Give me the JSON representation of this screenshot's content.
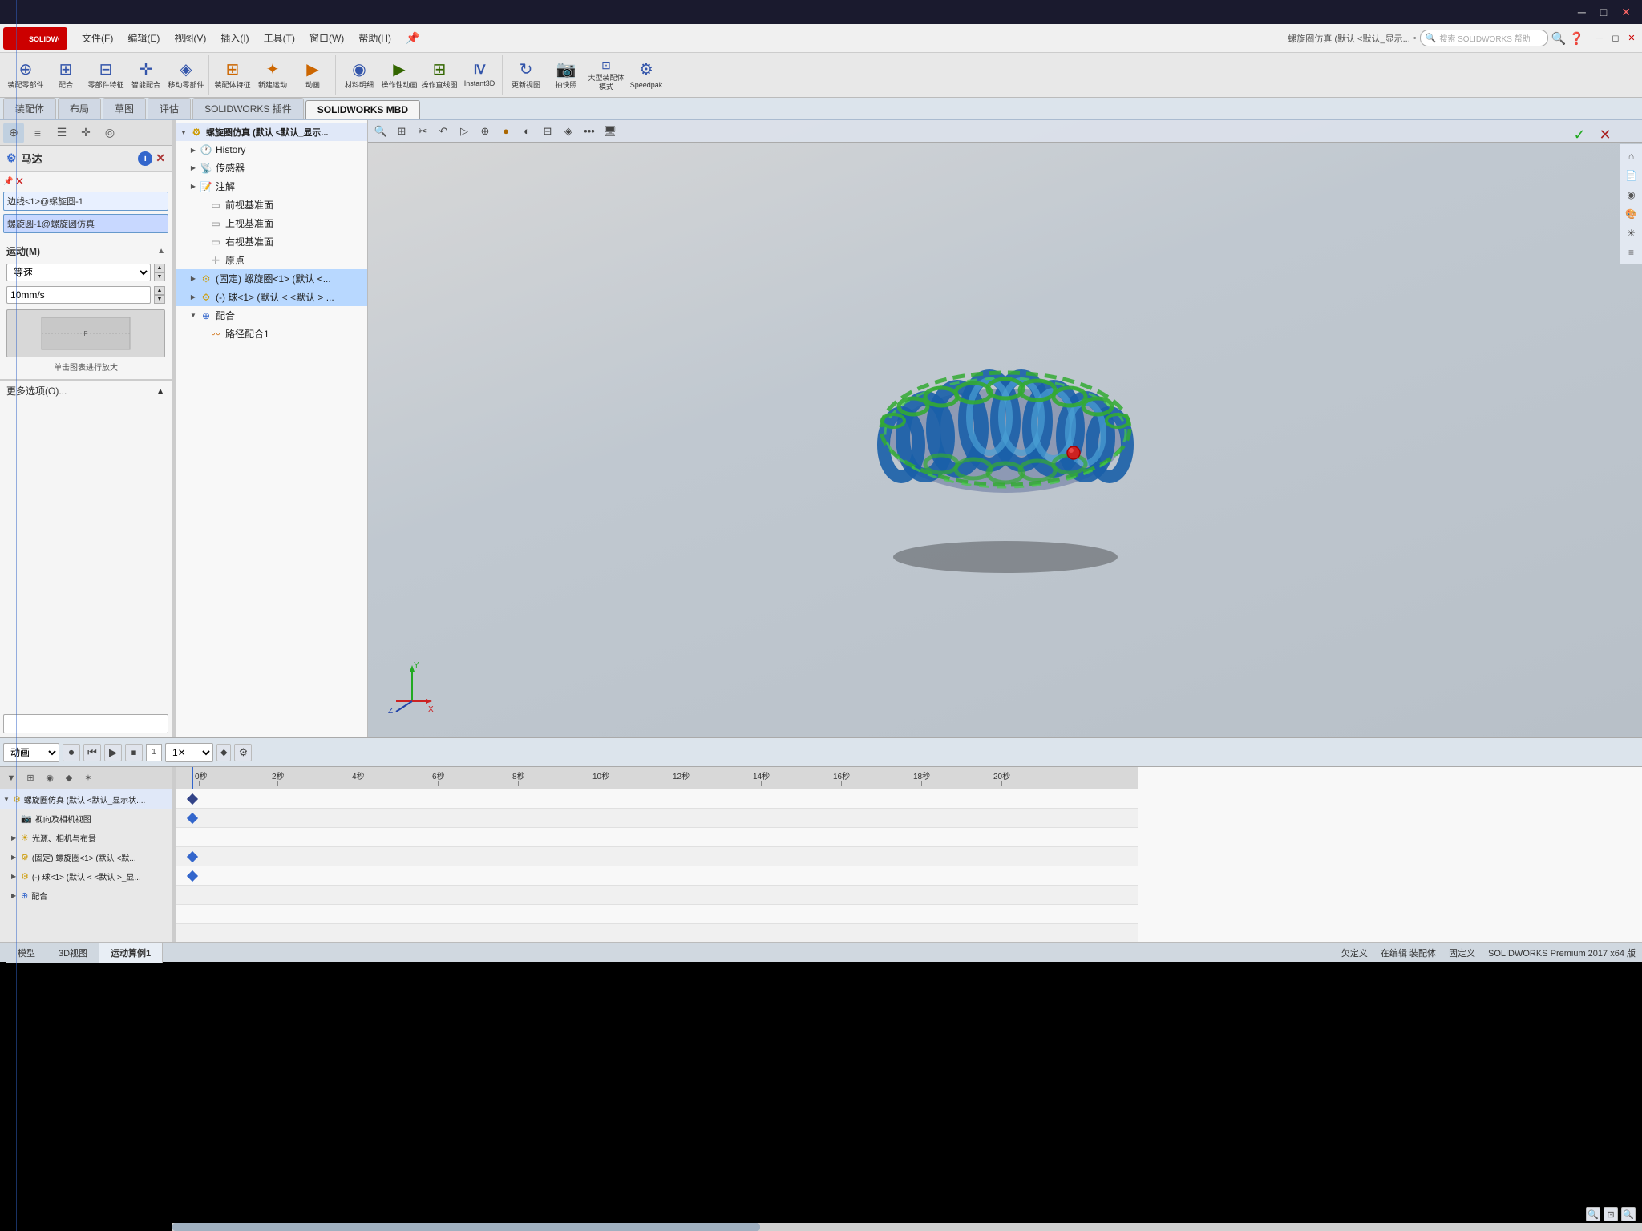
{
  "app": {
    "title": "SOLIDWORKS",
    "subtitle": "螺旋圈仿真 (默认 <默认_显示...",
    "version": "SOLIDWORKS Premium 2017 x64 版"
  },
  "titlebar": {
    "minimize": "─",
    "maximize": "□",
    "close": "✕"
  },
  "menubar": {
    "items": [
      {
        "label": "文件(F)"
      },
      {
        "label": "编辑(E)"
      },
      {
        "label": "视图(V)"
      },
      {
        "label": "插入(I)"
      },
      {
        "label": "工具(T)"
      },
      {
        "label": "窗口(W)"
      },
      {
        "label": "帮助(H)"
      }
    ],
    "search_placeholder": "搜索 SOLIDWORKS 帮助",
    "pin_label": "📌"
  },
  "toolbar": {
    "groups": [
      {
        "buttons": [
          {
            "icon": "◉",
            "label": "装配零部件",
            "color": "blue"
          },
          {
            "icon": "⊞",
            "label": "配合",
            "color": "blue"
          },
          {
            "icon": "⊟",
            "label": "零部件特征",
            "color": "blue"
          },
          {
            "icon": "✛",
            "label": "智能配合",
            "color": "blue"
          },
          {
            "icon": "⊕",
            "label": "移动零部件",
            "color": "blue"
          }
        ]
      },
      {
        "buttons": [
          {
            "icon": "⊞",
            "label": "装配体特征",
            "color": "orange"
          },
          {
            "icon": "✦",
            "label": "新建运动",
            "color": "orange"
          },
          {
            "icon": "⊞",
            "label": "动画",
            "color": "orange"
          }
        ]
      },
      {
        "buttons": [
          {
            "icon": "◈",
            "label": "材料明细",
            "color": "blue"
          },
          {
            "icon": "▶",
            "label": "操作性动画",
            "color": "green"
          },
          {
            "icon": "⊞",
            "label": "操作直线图",
            "color": "green"
          },
          {
            "icon": "Ⅳ",
            "label": "Instant3D",
            "color": "blue"
          }
        ]
      },
      {
        "buttons": [
          {
            "icon": "↻",
            "label": "更新视图",
            "color": "blue"
          },
          {
            "icon": "📷",
            "label": "拍快照",
            "color": "blue"
          },
          {
            "icon": "⊞",
            "label": "大型装配体模式",
            "color": "blue"
          },
          {
            "icon": "⚙",
            "label": "Speedpak",
            "color": "blue"
          }
        ]
      }
    ]
  },
  "tabs": [
    {
      "label": "装配体",
      "active": false
    },
    {
      "label": "布局",
      "active": false
    },
    {
      "label": "草图",
      "active": false
    },
    {
      "label": "评估",
      "active": false
    },
    {
      "label": "SOLIDWORKS 插件",
      "active": false
    },
    {
      "label": "SOLIDWORKS MBD",
      "active": false
    }
  ],
  "left_panel": {
    "icons": [
      "⊕",
      "≡",
      "☰",
      "✛",
      "◎"
    ],
    "title": "马达",
    "info_btn": "i",
    "close_btn": "✕",
    "edge_label": "边线<1>@螺旋圆-1",
    "assembly_label": "螺旋圆-1@螺旋圆仿真",
    "motion_section": {
      "title": "运动(M)",
      "motion_type": "等速",
      "speed_value": "10mm/s",
      "graph_label": "单击图表进行放大"
    },
    "more_options": "更多选项(O)...",
    "bottom_field": ""
  },
  "tree": {
    "root": {
      "label": "螺旋圈仿真 (默认 <默认_显示...",
      "icon": "⚙"
    },
    "items": [
      {
        "level": 1,
        "label": "History",
        "icon": "🕐",
        "expanded": false
      },
      {
        "level": 1,
        "label": "传感器",
        "icon": "📡",
        "expanded": false
      },
      {
        "level": 1,
        "label": "注解",
        "icon": "📝",
        "expanded": false
      },
      {
        "level": 2,
        "label": "前视基准面",
        "icon": "▭",
        "color": "gray"
      },
      {
        "level": 2,
        "label": "上视基准面",
        "icon": "▭",
        "color": "gray"
      },
      {
        "level": 2,
        "label": "右视基准面",
        "icon": "▭",
        "color": "gray"
      },
      {
        "level": 2,
        "label": "原点",
        "icon": "✛",
        "color": "gray"
      },
      {
        "level": 1,
        "label": "(固定) 螺旋圈<1> (默认 <...",
        "icon": "⚙",
        "highlighted": true,
        "color": "yellow"
      },
      {
        "level": 1,
        "label": "(-) 球<1> (默认 < <默认 > ...",
        "icon": "⚙",
        "highlighted": true,
        "color": "yellow"
      },
      {
        "level": 1,
        "label": "配合",
        "icon": "⊕",
        "expanded": true,
        "color": "blue"
      },
      {
        "level": 2,
        "label": "路径配合1",
        "icon": "~",
        "color": "orange"
      }
    ]
  },
  "viewport": {
    "toolbar_icons": [
      "🔍",
      "⊞",
      "✂",
      "↶",
      "▷",
      "⊕",
      "◉",
      "◐",
      "⊟",
      "◈",
      "🖥"
    ],
    "confirm": {
      "check": "✓",
      "cross": "✕"
    }
  },
  "animation_panel": {
    "type_select": "动画",
    "buttons": [
      {
        "icon": "⏮",
        "name": "go-start"
      },
      {
        "icon": "◀",
        "name": "step-back"
      },
      {
        "icon": "▶",
        "name": "play"
      },
      {
        "icon": "⏹",
        "name": "stop"
      }
    ],
    "speed_select": "1✕"
  },
  "timeline": {
    "ruler_marks": [
      "0秒",
      "2秒",
      "4秒",
      "6秒",
      "8秒",
      "10秒",
      "12秒",
      "14秒",
      "16秒",
      "18秒",
      "20秒"
    ],
    "header_icons": [
      "▼",
      "⊞",
      "◉",
      "⊕",
      "✶"
    ],
    "tracks": [
      {
        "label": "螺旋圈仿真 (默认 <默认_显示状....",
        "level": 0,
        "arrow": "▼",
        "icon": "⚙",
        "diamonds": [
          0
        ]
      },
      {
        "label": "视向及相机视图",
        "level": 1,
        "arrow": "",
        "icon": "📷",
        "diamonds": [
          0
        ]
      },
      {
        "label": "光源、相机与布景",
        "level": 1,
        "arrow": "▶",
        "icon": "☀",
        "diamonds": []
      },
      {
        "label": "(固定) 螺旋圈<1> (默认 <默...",
        "level": 1,
        "arrow": "▶",
        "icon": "⚙",
        "diamonds": [
          0
        ]
      },
      {
        "label": "(-) 球<1> (默认 < <默认 >_显...",
        "level": 1,
        "arrow": "▶",
        "icon": "⚙",
        "diamonds": [
          0
        ]
      },
      {
        "label": "配合",
        "level": 1,
        "arrow": "▶",
        "icon": "⊕",
        "diamonds": []
      }
    ]
  },
  "statusbar": {
    "tabs": [
      {
        "label": "模型",
        "active": false
      },
      {
        "label": "3D视图",
        "active": false
      },
      {
        "label": "运动算例1",
        "active": true
      }
    ],
    "status_items": [
      "欠定义",
      "在编辑 装配体",
      "固定义",
      ""
    ]
  }
}
